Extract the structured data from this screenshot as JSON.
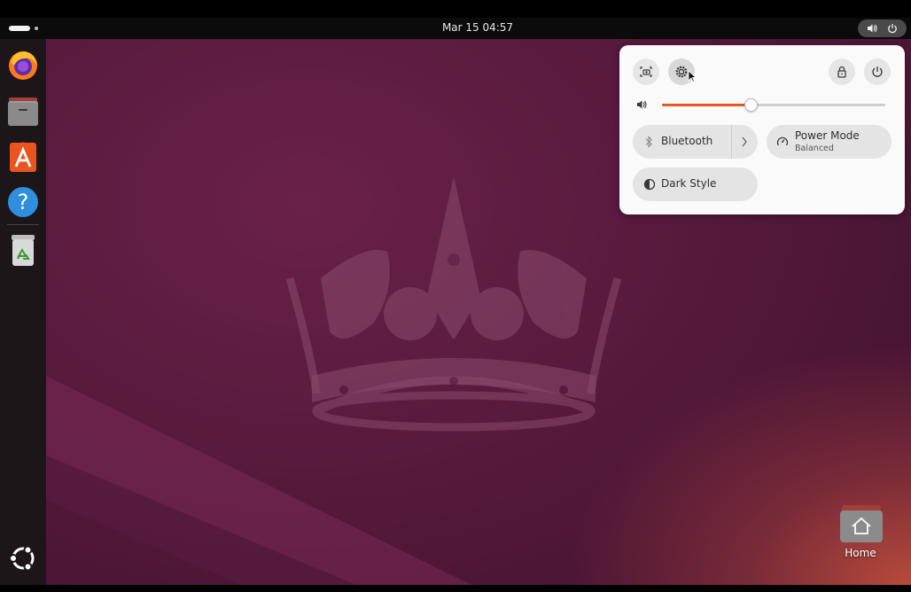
{
  "topbar": {
    "clock": "Mar 15  04:57",
    "activities_icon": "activities-indicator",
    "systray_icons": [
      "speaker-icon",
      "power-icon"
    ]
  },
  "dock": {
    "items": [
      {
        "name": "Firefox",
        "icon": "firefox-icon"
      },
      {
        "name": "Files",
        "icon": "files-icon"
      },
      {
        "name": "App Center",
        "icon": "app-center-icon"
      },
      {
        "name": "Help",
        "icon": "help-icon"
      },
      {
        "name": "Trash",
        "icon": "trash-icon"
      }
    ],
    "show_apps_icon": "ubuntu-logo-icon"
  },
  "desktop": {
    "home_label": "Home",
    "home_icon": "home-folder-icon"
  },
  "quick_settings": {
    "top_buttons": [
      "screenshot-icon",
      "settings-icon",
      "lock-icon",
      "power-icon"
    ],
    "volume_level": 0.4,
    "volume_icon": "speaker-icon",
    "bluetooth_label": "Bluetooth",
    "bluetooth_icon": "bluetooth-icon",
    "power_mode_title": "Power Mode",
    "power_mode_subtitle": "Balanced",
    "power_mode_icon": "power-mode-icon",
    "dark_style_label": "Dark Style",
    "dark_style_icon": "dark-style-icon"
  },
  "colors": {
    "accent": "#e95420",
    "panel_bg": "#fafafa",
    "dock_bg": "#1d1619",
    "topbar_bg": "#0b0b0b"
  }
}
